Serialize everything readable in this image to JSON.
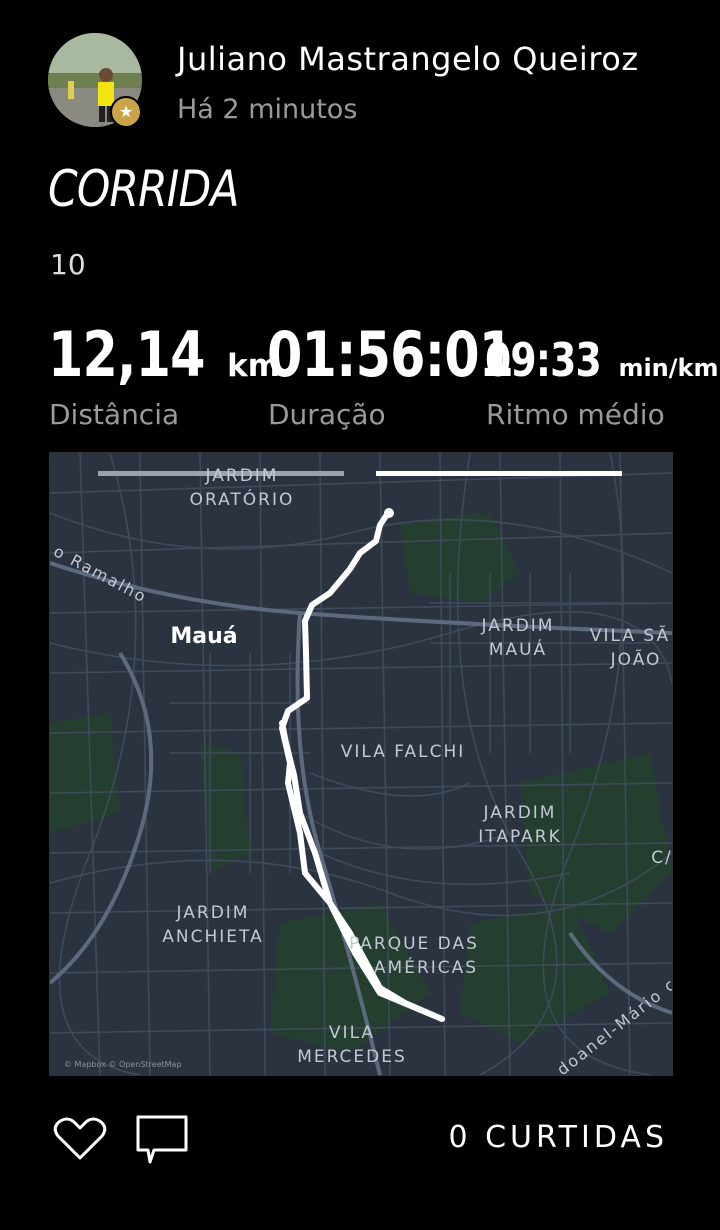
{
  "user": {
    "name": "Juliano Mastrangelo Queiroz",
    "posted": "Há 2 minutos",
    "badge_icon": "star-icon"
  },
  "activity": {
    "type": "CORRIDA",
    "subtitle": "10",
    "stats": [
      {
        "value": "12,14",
        "unit": "km",
        "label": "Distância"
      },
      {
        "value": "01:56:01",
        "unit": "",
        "label": "Duração"
      },
      {
        "value": "09:33",
        "unit": "min/km",
        "label": "Ritmo médio"
      }
    ]
  },
  "map": {
    "labels": {
      "jardim_oratorio": [
        "JARDIM",
        "ORATÓRIO"
      ],
      "maua": "Mauá",
      "ramalho": "o Ramalho",
      "jardim_maua": [
        "JARDIM",
        "MAUÁ"
      ],
      "vila_sao_joao": [
        "VILA SÃ",
        "JOÃO"
      ],
      "vila_falchi": "VILA FALCHI",
      "jardim_itapark": [
        "JARDIM",
        "ITAPARK"
      ],
      "jardim_anchieta": [
        "JARDIM",
        "ANCHIETA"
      ],
      "parque_americas": [
        "PARQUE DAS",
        "AMÉRICAS"
      ],
      "vila_mercedes": [
        "VILA",
        "MERCEDES"
      ],
      "road_mario": "doanel-Mário c",
      "edge_c": "C/",
      "attribution": "© Mapbox © OpenStreetMap"
    },
    "route_color": "#ffffff",
    "background_color": "#2b3340"
  },
  "footer": {
    "likes": "0 CURTIDAS",
    "like_icon": "heart-icon",
    "comment_icon": "comment-icon"
  }
}
